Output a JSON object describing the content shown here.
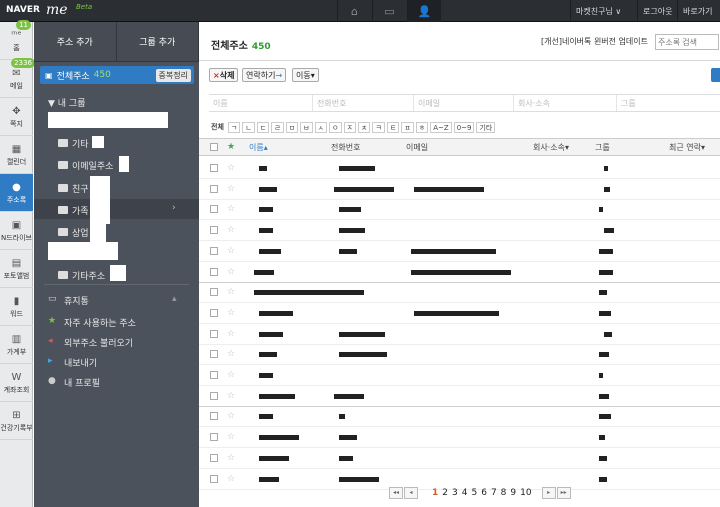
{
  "topbar": {
    "brand": "NAVER",
    "logo": "me",
    "beta": "Beta",
    "icons": [
      "home-icon",
      "window-icon",
      "contacts-icon"
    ],
    "user": "마켓친구님 ∨",
    "logout": "로그아웃",
    "shortcut": "바로가기"
  },
  "leftnav": {
    "items": [
      {
        "label": "홈",
        "badge": "11",
        "icon": "home-icon"
      },
      {
        "label": "메일",
        "badge": "2336",
        "icon": "mail-icon"
      },
      {
        "label": "쪽지",
        "icon": "note-icon"
      },
      {
        "label": "캘린더",
        "icon": "calendar-icon"
      },
      {
        "label": "주소록",
        "icon": "contacts-icon"
      },
      {
        "label": "N드라이브",
        "icon": "drive-icon"
      },
      {
        "label": "포토앨범",
        "icon": "photo-icon"
      },
      {
        "label": "워드",
        "icon": "word-icon"
      },
      {
        "label": "가계부",
        "icon": "ledger-icon"
      },
      {
        "label": "계좌조회",
        "icon": "bank-icon"
      },
      {
        "label": "건강기록부",
        "icon": "health-icon"
      }
    ]
  },
  "folders": {
    "add_address": "주소 추가",
    "add_group": "그룹 추가",
    "all_label": "전체주소",
    "all_count": "450",
    "dedupe": "중복정리",
    "my_groups": "▼ 내 그룹",
    "groups": [
      "기타",
      "이메일주소",
      "친구",
      "가족",
      "상업"
    ],
    "other_address": "기타주소",
    "trash": "휴지통",
    "frequent": "자주 사용하는 주소",
    "import": "외부주소 불러오기",
    "export": "내보내기",
    "profile": "내 프로필"
  },
  "main": {
    "title": "전체주소",
    "count": "450",
    "notice": "[개선]네이버톡 윈버전 업데이트",
    "search_placeholder": "주소록 검색",
    "toolbar": {
      "delete": "삭제",
      "contact": "연락하기",
      "move": "이동"
    },
    "filters": [
      "이름",
      "전화번호",
      "이메일",
      "회사·소속",
      "그룹"
    ],
    "index": [
      "전체",
      "ㄱ",
      "ㄴ",
      "ㄷ",
      "ㄹ",
      "ㅁ",
      "ㅂ",
      "ㅅ",
      "ㅇ",
      "ㅈ",
      "ㅊ",
      "ㅋ",
      "ㅌ",
      "ㅍ",
      "ㅎ",
      "A~Z",
      "0~9",
      "기타"
    ],
    "columns": [
      "이름",
      "전화번호",
      "이메일",
      "회사·소속",
      "그룹",
      "최근 연락"
    ],
    "pager": {
      "pages": [
        "1",
        "2",
        "3",
        "4",
        "5",
        "6",
        "7",
        "8",
        "9",
        "10"
      ],
      "current": "1"
    }
  },
  "colors": {
    "accent": "#2f7cc4",
    "green": "#7cc342",
    "panel": "#4c525c",
    "topbar": "#2b2e33"
  }
}
